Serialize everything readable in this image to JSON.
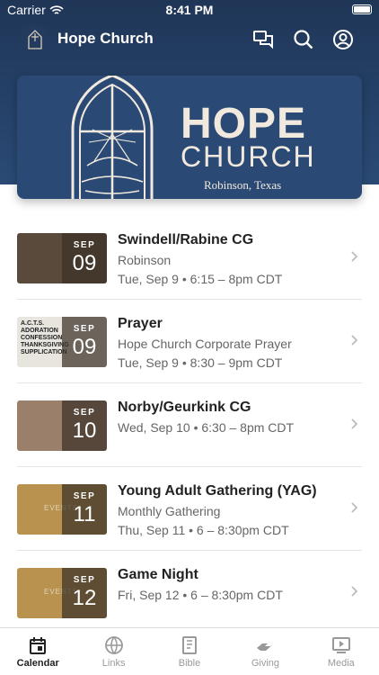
{
  "status": {
    "carrier": "Carrier",
    "time": "8:41 PM"
  },
  "header": {
    "title": "Hope Church"
  },
  "hero": {
    "line1": "HOPE",
    "line2": "CHURCH",
    "location": "Robinson, Texas"
  },
  "events": [
    {
      "title": "Swindell/Rabine CG",
      "subtitle": "Robinson",
      "when": "Tue, Sep 9 • 6:15 – 8pm CDT",
      "month": "SEP",
      "day": "09",
      "thumb_color": "#5a4a3c"
    },
    {
      "title": "Prayer",
      "subtitle": "Hope Church Corporate Prayer",
      "when": "Tue, Sep 9 • 8:30 – 9pm CDT",
      "month": "SEP",
      "day": "09",
      "thumb_color": "#e8e4de",
      "thumb_text": [
        "A.C.T.S.",
        "ADORATION",
        "CONFESSION",
        "THANKSGIVING",
        "SUPPLICATION"
      ]
    },
    {
      "title": "Norby/Geurkink CG",
      "subtitle": "",
      "when": "Wed, Sep 10 • 6:30 – 8pm CDT",
      "month": "SEP",
      "day": "10",
      "thumb_color": "#9a7f6a"
    },
    {
      "title": "Young Adult Gathering (YAG)",
      "subtitle": "Monthly Gathering",
      "when": "Thu, Sep 11 • 6 – 8:30pm CDT",
      "month": "SEP",
      "day": "11",
      "thumb_color": "#b8924e",
      "thumb_text": [
        "EVENTS"
      ]
    },
    {
      "title": "Game Night",
      "subtitle": "",
      "when": "Fri, Sep 12 • 6 – 8:30pm CDT",
      "month": "SEP",
      "day": "12",
      "thumb_color": "#b8924e",
      "thumb_text": [
        "EVENTS"
      ]
    }
  ],
  "tabs": [
    {
      "label": "Calendar",
      "icon": "calendar-icon",
      "active": true
    },
    {
      "label": "Links",
      "icon": "globe-icon"
    },
    {
      "label": "Bible",
      "icon": "book-icon"
    },
    {
      "label": "Giving",
      "icon": "hand-icon"
    },
    {
      "label": "Media",
      "icon": "play-icon"
    }
  ]
}
